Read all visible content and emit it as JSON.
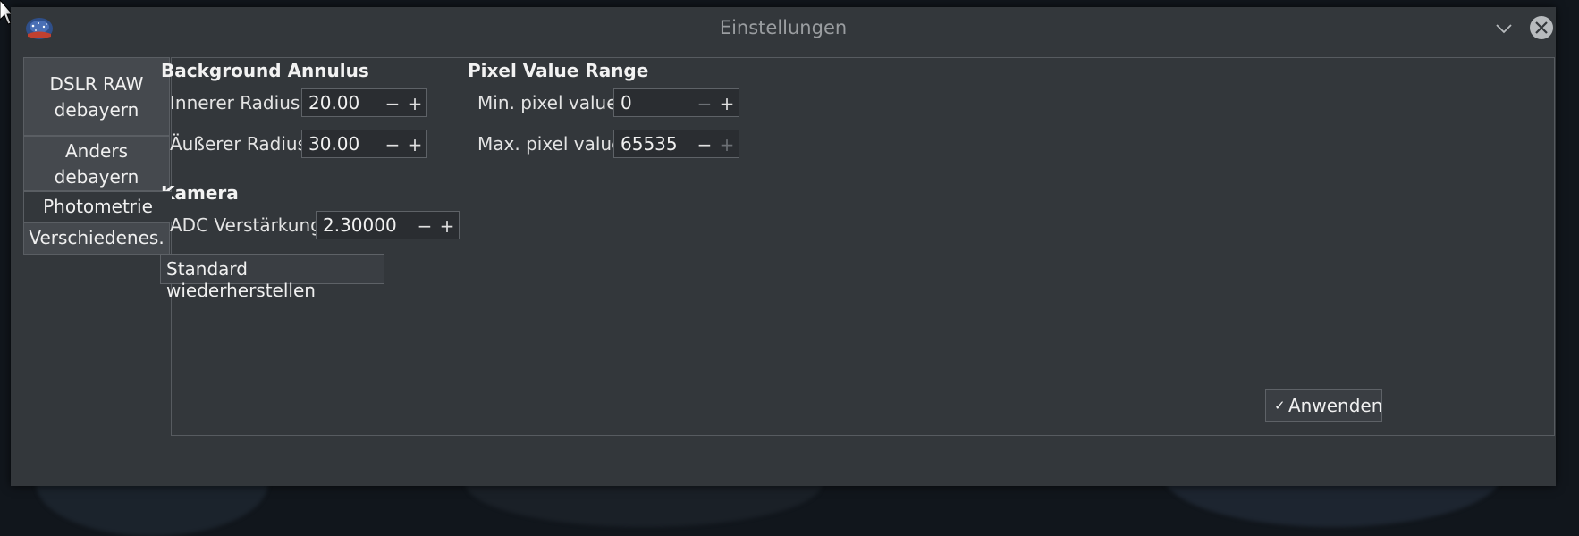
{
  "window": {
    "title": "Einstellungen"
  },
  "tabs": [
    {
      "line1": "DSLR RAW",
      "line2": "debayern"
    },
    {
      "line1": "Anders",
      "line2": "debayern"
    },
    {
      "label": "Photometrie"
    },
    {
      "label": "Verschiedenes."
    }
  ],
  "background_annulus": {
    "title": "Background Annulus",
    "inner_label": "Innerer Radius:",
    "inner_value": "20.00",
    "outer_label": "Äußerer Radius:",
    "outer_value": "30.00"
  },
  "pixel_range": {
    "title": "Pixel Value Range",
    "min_label": "Min. pixel value:",
    "min_value": "0",
    "max_label": "Max. pixel value:",
    "max_value": "65535"
  },
  "camera": {
    "title": "Kamera",
    "adc_label": "ADC Verstärkung:",
    "adc_value": "2.30000"
  },
  "buttons": {
    "restore_label": "Standard wiederherstellen",
    "apply_label": "Anwenden"
  },
  "glyphs": {
    "minus": "−",
    "plus": "+",
    "check": "✓"
  }
}
